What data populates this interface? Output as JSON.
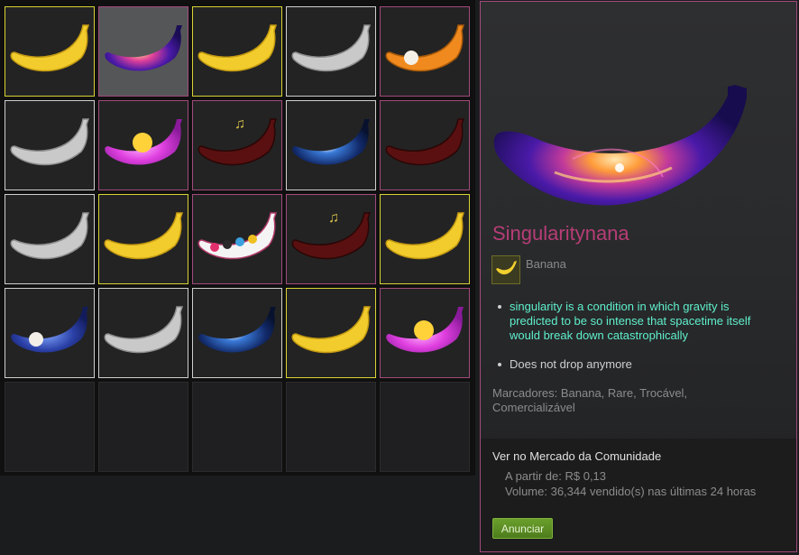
{
  "inventory": {
    "slots": [
      {
        "item": "yellow-banana",
        "rarity_border": "#d8d335"
      },
      {
        "item": "singularity-banana",
        "rarity_border": "#a14a7c",
        "selected": true
      },
      {
        "item": "yellow-banana",
        "rarity_border": "#d8d335"
      },
      {
        "item": "gray-banana",
        "rarity_border": "#cfcfcf"
      },
      {
        "item": "orange-cartoon-banana",
        "rarity_border": "#a14a7c"
      },
      {
        "item": "gray-banana",
        "rarity_border": "#cfcfcf"
      },
      {
        "item": "pink-retro-banana",
        "rarity_border": "#a14a7c"
      },
      {
        "item": "dark-red-music-banana",
        "rarity_border": "#a14a7c"
      },
      {
        "item": "space-eye-banana",
        "rarity_border": "#cfcfcf"
      },
      {
        "item": "dark-red-banana",
        "rarity_border": "#a14a7c"
      },
      {
        "item": "gray-banana",
        "rarity_border": "#cfcfcf"
      },
      {
        "item": "yellow-banana",
        "rarity_border": "#d8d335"
      },
      {
        "item": "sticker-banana",
        "rarity_border": "#a14a7c"
      },
      {
        "item": "dark-red-music-banana",
        "rarity_border": "#a14a7c"
      },
      {
        "item": "yellow-banana",
        "rarity_border": "#d8d335"
      },
      {
        "item": "blue-meme-banana",
        "rarity_border": "#cfcfcf"
      },
      {
        "item": "gray-banana",
        "rarity_border": "#cfcfcf"
      },
      {
        "item": "space-eye-banana",
        "rarity_border": "#cfcfcf"
      },
      {
        "item": "yellow-banana",
        "rarity_border": "#d8d335"
      },
      {
        "item": "pink-retro-banana",
        "rarity_border": "#a14a7c"
      },
      {
        "item": "empty"
      },
      {
        "item": "empty"
      },
      {
        "item": "empty"
      },
      {
        "item": "empty"
      },
      {
        "item": "empty"
      }
    ]
  },
  "details": {
    "name": "Singularitynana",
    "name_color": "#b63d76",
    "game_name": "Banana",
    "descriptions": [
      "singularity is a condition in which gravity is predicted to be so intense that spacetime itself would break down catastrophically",
      "Does not drop anymore"
    ],
    "tags": "Marcadores: Banana, Rare, Trocável, Comercializável",
    "market": {
      "title": "Ver no Mercado da Comunidade",
      "price": "A partir de: R$ 0,13",
      "volume": "Volume: 36,344 vendido(s) nas últimas 24 horas",
      "sell_label": "Anunciar"
    }
  }
}
